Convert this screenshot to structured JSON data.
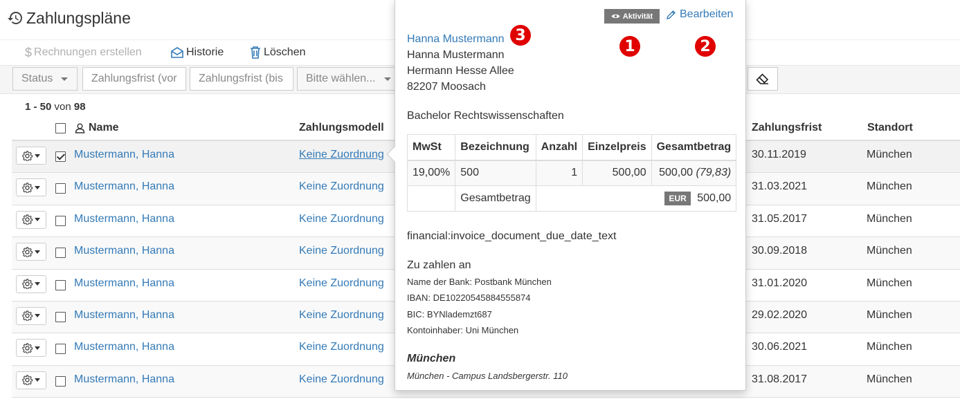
{
  "page": {
    "title": "Zahlungspläne"
  },
  "toolbar": {
    "create_invoices": "Rechnungen erstellen",
    "history": "Historie",
    "delete": "Löschen"
  },
  "filters": {
    "status": "Status",
    "due_from": "Zahlungsfrist (vor",
    "due_to": "Zahlungsfrist (bis",
    "choose": "Bitte wählen..."
  },
  "pagination": {
    "range": "1 - 50",
    "of_label": "von",
    "total": "98"
  },
  "table": {
    "headers": {
      "name": "Name",
      "model": "Zahlungsmodell",
      "due": "Zahlungsfrist",
      "location": "Standort"
    },
    "rows": [
      {
        "name": "Mustermann, Hanna",
        "model": "Keine Zuordnung",
        "due": "30.11.2019",
        "location": "München",
        "checked": true
      },
      {
        "name": "Mustermann, Hanna",
        "model": "Keine Zuordnung",
        "due": "31.03.2021",
        "location": "München",
        "checked": false
      },
      {
        "name": "Mustermann, Hanna",
        "model": "Keine Zuordnung",
        "due": "31.05.2017",
        "location": "München",
        "checked": false
      },
      {
        "name": "Mustermann, Hanna",
        "model": "Keine Zuordnung",
        "due": "30.09.2018",
        "location": "München",
        "checked": false
      },
      {
        "name": "Mustermann, Hanna",
        "model": "Keine Zuordnung",
        "due": "31.01.2020",
        "location": "München",
        "checked": false
      },
      {
        "name": "Mustermann, Hanna",
        "model": "Keine Zuordnung",
        "due": "29.02.2020",
        "location": "München",
        "checked": false
      },
      {
        "name": "Mustermann, Hanna",
        "model": "Keine Zuordnung",
        "due": "30.06.2021",
        "location": "München",
        "checked": false
      },
      {
        "name": "Mustermann, Hanna",
        "model": "Keine Zuordnung",
        "due": "31.08.2017",
        "location": "München",
        "checked": false
      }
    ]
  },
  "popover": {
    "activity_label": "Aktivität",
    "edit_label": "Bearbeiten",
    "markers": [
      "1",
      "2",
      "3"
    ],
    "contact_link": "Hanna Mustermann",
    "address": [
      "Hanna Mustermann",
      "Hermann Hesse Allee",
      "82207 Moosach"
    ],
    "program": "Bachelor Rechtswissenschaften",
    "items_table": {
      "headers": [
        "MwSt",
        "Bezeichnung",
        "Anzahl",
        "Einzelpreis",
        "Gesamtbetrag"
      ],
      "row": {
        "vat": "19,00%",
        "description": "500",
        "quantity": "1",
        "unit_price": "500,00",
        "total": "500,00",
        "tax": "(79,83)"
      },
      "total_label": "Gesamtbetrag",
      "currency": "EUR",
      "total_value": "500,00"
    },
    "due_text": "financial:invoice_document_due_date_text",
    "pay_to_title": "Zu zahlen an",
    "bank_lines": [
      "Name der Bank: Postbank München",
      "IBAN: DE10220545884555874",
      "BIC: BYNlademzt687",
      "Kontoinhaber: Uni München"
    ],
    "location_title": "München",
    "location_detail": "München - Campus Landsbergerstr. 110"
  },
  "colors": {
    "link": "#337ab7",
    "marker": "#e00000",
    "badge": "#777777"
  }
}
